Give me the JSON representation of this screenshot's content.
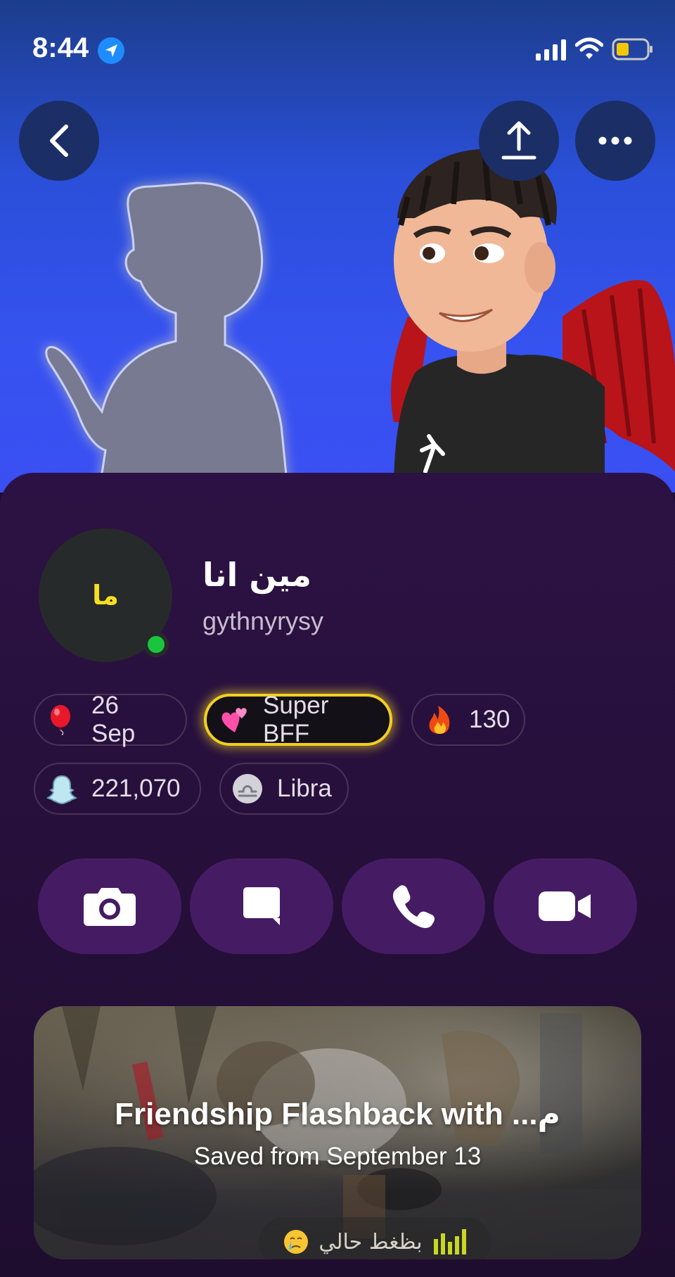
{
  "status_bar": {
    "time": "8:44",
    "icons": [
      "location-arrow-icon",
      "signal-icon",
      "wifi-icon",
      "battery-icon"
    ],
    "battery_color": "#f2c800"
  },
  "header": {
    "back_icon": "chevron-left-icon",
    "share_icon": "share-upload-icon",
    "more_icon": "more-dots-icon"
  },
  "profile": {
    "initials": "ما",
    "display_name": "مين انا",
    "username": "gythnyrysy",
    "online": true,
    "online_color": "#19c53d"
  },
  "chips": {
    "birthday": {
      "icon": "balloon-icon",
      "label": "26 Sep"
    },
    "friendship": {
      "icon": "two-hearts-icon",
      "label": "Super BFF"
    },
    "streak": {
      "icon": "fire-icon",
      "label": "130"
    },
    "score": {
      "icon": "snap-ghost-icon",
      "label": "221,070"
    },
    "zodiac": {
      "icon": "libra-icon",
      "label": "Libra"
    }
  },
  "actions": [
    {
      "icon": "camera-icon"
    },
    {
      "icon": "chat-icon"
    },
    {
      "icon": "phone-icon"
    },
    {
      "icon": "video-icon"
    }
  ],
  "flashback": {
    "title": "Friendship Flashback with ...م",
    "subtitle": "Saved from September 13",
    "caption": "بظغط حالي",
    "caption_emoji": "crying-face-icon"
  },
  "colors": {
    "hero_blue": "#3652f0",
    "card_purple": "#2c1244",
    "action_button": "#451c64",
    "bff_glow": "#f0d020"
  }
}
